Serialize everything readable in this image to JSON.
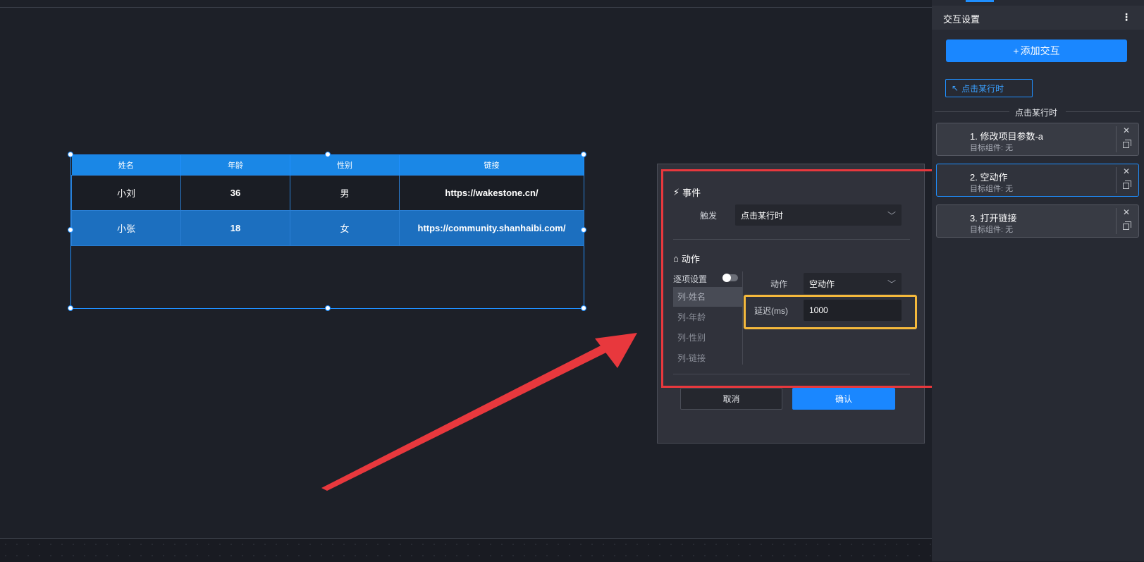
{
  "table": {
    "headers": [
      "姓名",
      "年龄",
      "性别",
      "链接"
    ],
    "rows": [
      [
        "小刘",
        "36",
        "男",
        "https://wakestone.cn/"
      ],
      [
        "小张",
        "18",
        "女",
        "https://community.shanhaibi.com/"
      ]
    ]
  },
  "dialog": {
    "event_section": "事件",
    "trigger_label": "触发",
    "trigger_value": "点击某行时",
    "action_section": "动作",
    "per_item_label": "逐项设置",
    "per_item_enabled": false,
    "columns": [
      "列-姓名",
      "列-年龄",
      "列-性别",
      "列-链接"
    ],
    "action_label": "动作",
    "action_value": "空动作",
    "delay_label": "延迟(ms)",
    "delay_value": "1000",
    "cancel_label": "取消",
    "confirm_label": "确认"
  },
  "panel": {
    "title": "交互设置",
    "add_button": "添加交互",
    "trigger_tag": "点击某行时",
    "section_label": "点击某行时",
    "actions": [
      {
        "title": "1. 修改项目参数-a",
        "sub": "目标组件: 无"
      },
      {
        "title": "2. 空动作",
        "sub": "目标组件: 无"
      },
      {
        "title": "3. 打开链接",
        "sub": "目标组件: 无"
      }
    ]
  },
  "colors": {
    "accent": "#1a87ff",
    "highlight_red": "#e8383d",
    "highlight_yellow": "#f5b93c"
  }
}
